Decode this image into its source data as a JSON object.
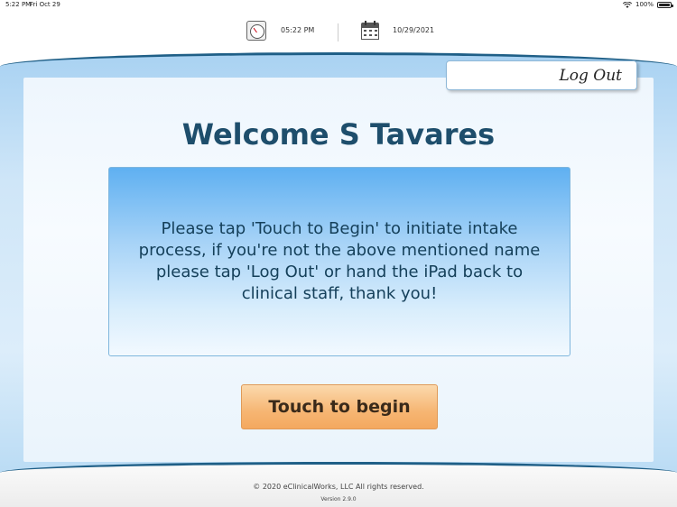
{
  "status_bar": {
    "time": "5:22 PM",
    "date": "Fri Oct 29",
    "battery": "100%",
    "icons": [
      "wifi-icon",
      "battery-icon"
    ]
  },
  "header": {
    "time": "05:22 PM",
    "date": "10/29/2021",
    "icons": [
      "clock-icon",
      "calendar-icon"
    ]
  },
  "logout_label": "Log Out",
  "welcome_title": "Welcome S Tavares",
  "instructions": "Please tap 'Touch to Begin' to initiate intake process, if you're not the above mentioned name please tap 'Log Out' or hand the iPad back to clinical staff, thank you!",
  "begin_button": "Touch to begin",
  "footer": {
    "copyright": "© 2020 eClinicalWorks, LLC All rights reserved.",
    "version": "Version 2.9.0"
  },
  "colors": {
    "title": "#1e4e6c",
    "frame_border": "#1f5f87",
    "button": "#f6b673"
  }
}
